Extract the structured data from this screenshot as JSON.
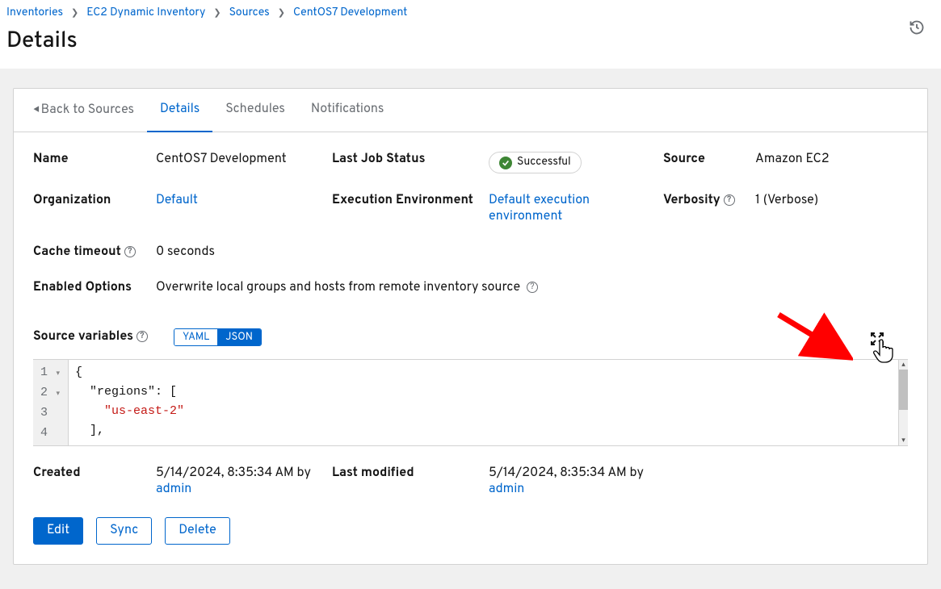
{
  "breadcrumb": {
    "inventories": "Inventories",
    "inventory_name": "EC2 Dynamic Inventory",
    "sources": "Sources",
    "source_name": "CentOS7 Development"
  },
  "page_title": "Details",
  "tabs": {
    "back": "Back to Sources",
    "details": "Details",
    "schedules": "Schedules",
    "notifications": "Notifications"
  },
  "fields": {
    "name_label": "Name",
    "name_value": "CentOS7 Development",
    "last_job_status_label": "Last Job Status",
    "last_job_status_value": "Successful",
    "source_label": "Source",
    "source_value": "Amazon EC2",
    "organization_label": "Organization",
    "organization_value": "Default",
    "exec_env_label": "Execution Environment",
    "exec_env_value": "Default execution environment",
    "verbosity_label": "Verbosity",
    "verbosity_value": "1 (Verbose)",
    "cache_timeout_label": "Cache timeout",
    "cache_timeout_value": "0 seconds",
    "enabled_options_label": "Enabled Options",
    "enabled_options_value": "Overwrite local groups and hosts from remote inventory source",
    "source_variables_label": "Source variables",
    "created_label": "Created",
    "created_value": "5/14/2024, 8:35:34 AM by",
    "created_by": "admin",
    "last_modified_label": "Last modified",
    "last_modified_value": "5/14/2024, 8:35:34 AM by",
    "last_modified_by": "admin"
  },
  "toggle": {
    "yaml": "YAML",
    "json": "JSON"
  },
  "code": {
    "l1": "{",
    "l2a": "  \"regions\": [",
    "l3_indent": "    ",
    "l3_str": "\"us-east-2\"",
    "l4": "  ],"
  },
  "gutter": {
    "g1": "1",
    "g2": "2",
    "g3": "3",
    "g4": "4"
  },
  "actions": {
    "edit": "Edit",
    "sync": "Sync",
    "delete": "Delete"
  }
}
